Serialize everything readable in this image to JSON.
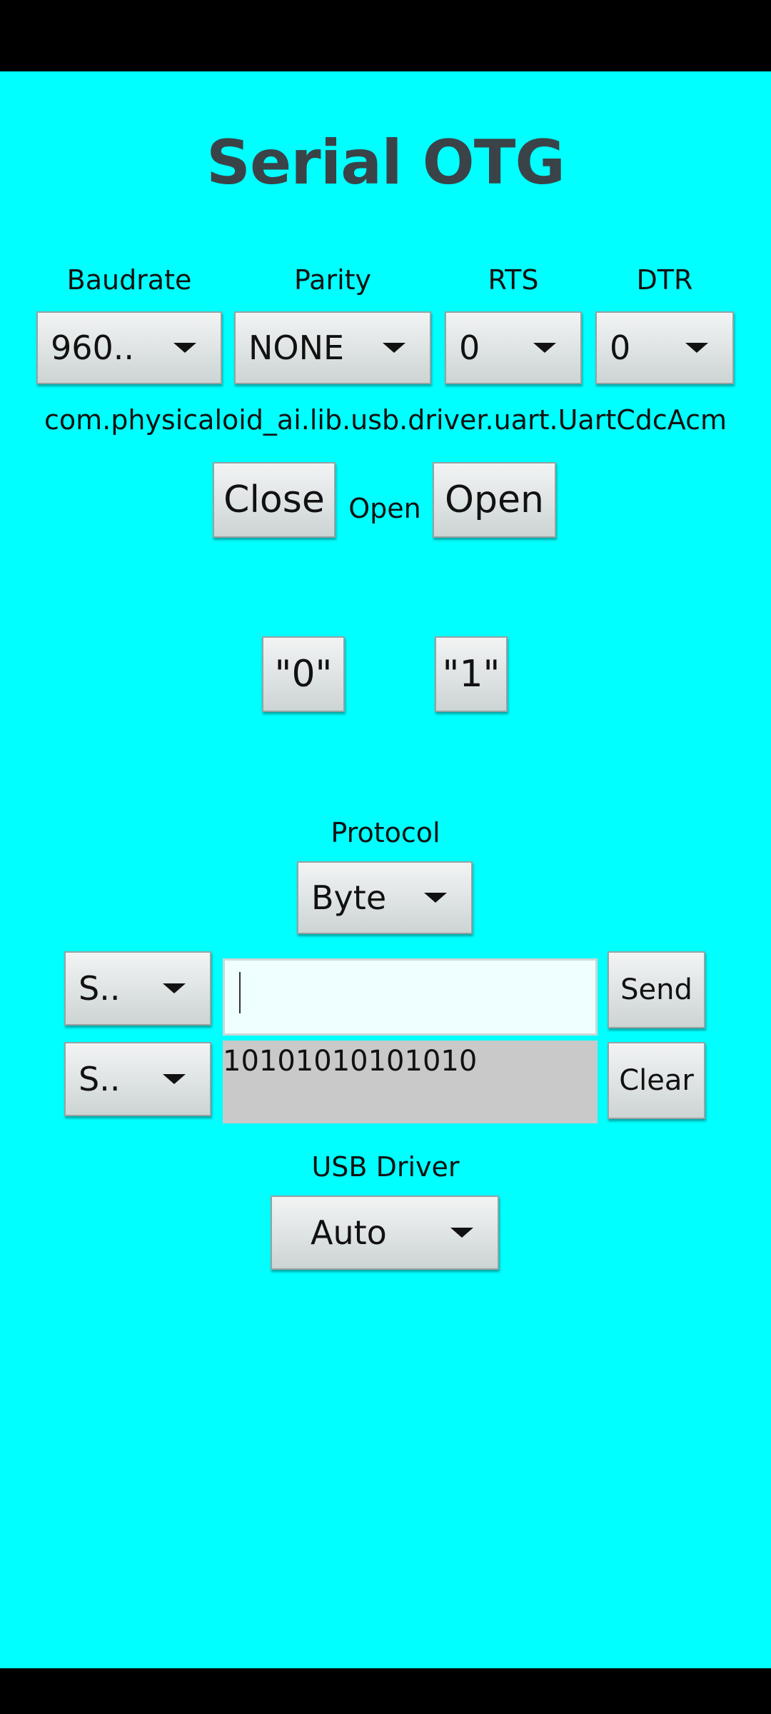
{
  "app": {
    "title": "Serial OTG"
  },
  "config": {
    "baudrate": {
      "label": "Baudrate",
      "value": "960.."
    },
    "parity": {
      "label": "Parity",
      "value": "NONE"
    },
    "rts": {
      "label": "RTS",
      "value": "0"
    },
    "dtr": {
      "label": "DTR",
      "value": "0"
    }
  },
  "driver_class": "com.physicaloid_ai.lib.usb.driver.uart.UartCdcAcm",
  "connection": {
    "close_label": "Close",
    "status": "Open",
    "open_label": "Open"
  },
  "bits": {
    "zero_label": "\"0\"",
    "one_label": "\"1\""
  },
  "protocol": {
    "label": "Protocol",
    "value": "Byte"
  },
  "send": {
    "mode_value": "S..",
    "input_value": "",
    "button_label": "Send"
  },
  "receive": {
    "mode_value": "S..",
    "output_text": "10101010101010",
    "button_label": "Clear"
  },
  "usb_driver": {
    "label": "USB Driver",
    "value": "Auto"
  },
  "colors": {
    "background": "#00ffff",
    "title": "#3a4448",
    "input_bg": "#efffff",
    "output_bg": "#c9c9c9"
  },
  "icons": {
    "dropdown": "triangle-down-icon"
  }
}
